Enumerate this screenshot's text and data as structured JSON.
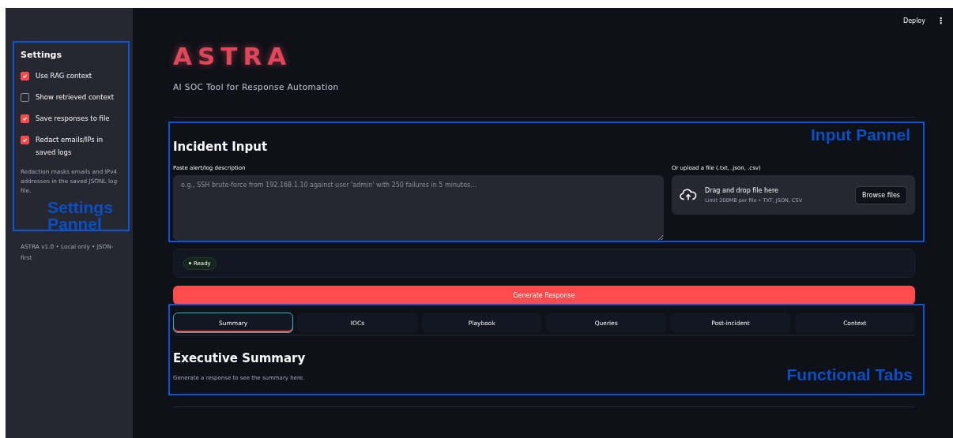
{
  "toolbar": {
    "deploy": "Deploy",
    "menu": "⋮"
  },
  "sidebar": {
    "title": "Settings",
    "options": [
      {
        "label": "Use RAG context",
        "checked": true
      },
      {
        "label": "Show retrieved context",
        "checked": false
      },
      {
        "label": "Save responses to file",
        "checked": true
      },
      {
        "label": "Redact emails/IPs in saved logs",
        "checked": true
      }
    ],
    "caption": "Redaction masks emails and IPv4 addresses in the saved JSONL log file.",
    "footer": "ASTRA v1.0 • Local only • JSON-first"
  },
  "header": {
    "title": "ASTRA",
    "subtitle": "AI SOC Tool for Response Automation"
  },
  "incident_input": {
    "heading": "Incident Input",
    "text_label": "Paste alert/log description",
    "placeholder": "e.g., SSH brute-force from 192.168.1.10 against user 'admin' with 250 failures in 5 minutes…",
    "upload": {
      "label": "Or upload a file (.txt, .json, .csv)",
      "title": "Drag and drop file here",
      "hint": "Limit 200MB per file • TXT, JSON, CSV",
      "button": "Browse files"
    }
  },
  "status": {
    "label": "Ready"
  },
  "generate_button": "Generate Response",
  "tabs": [
    {
      "label": "Summary",
      "selected": true
    },
    {
      "label": "IOCs",
      "selected": false
    },
    {
      "label": "Playbook",
      "selected": false
    },
    {
      "label": "Queries",
      "selected": false
    },
    {
      "label": "Post-incident",
      "selected": false
    },
    {
      "label": "Context",
      "selected": false
    }
  ],
  "tab_content": {
    "heading": "Executive Summary",
    "text": "Generate a response to see the summary here."
  },
  "annotations": [
    {
      "kind": "settings",
      "label": "Settings Pannel"
    },
    {
      "kind": "input",
      "label": "Input Pannel"
    },
    {
      "kind": "tabs",
      "label": "Functional Tabs"
    }
  ]
}
